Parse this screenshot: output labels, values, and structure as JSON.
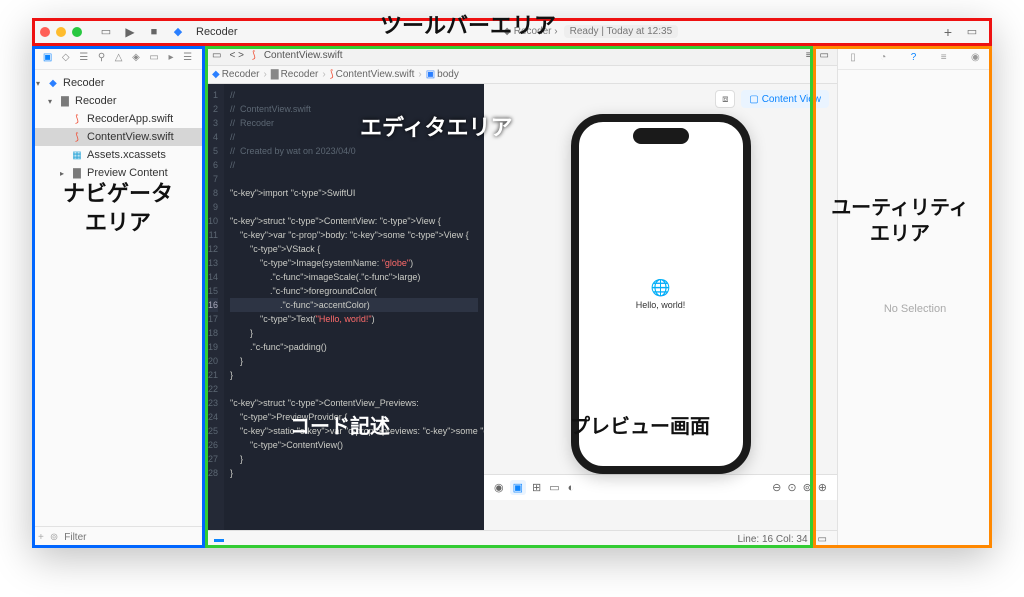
{
  "toolbar": {
    "app_title": "Recoder",
    "tab_label": "Recoder",
    "status_ready": "Ready",
    "status_time": "Today at 12:35"
  },
  "navigator": {
    "project": "Recoder",
    "target": "Recoder",
    "files": {
      "app": "RecoderApp.swift",
      "contentview": "ContentView.swift",
      "assets": "Assets.xcassets",
      "preview": "Preview Content"
    },
    "filter_placeholder": "Filter"
  },
  "editor": {
    "tab_file": "ContentView.swift",
    "crumb_app": "Recoder",
    "crumb_target": "Recoder",
    "crumb_file": "ContentView.swift",
    "crumb_symbol": "body",
    "code_lines": [
      "//",
      "//  ContentView.swift",
      "//  Recoder",
      "//",
      "//  Created by wat on 2023/04/0",
      "//",
      "",
      "import SwiftUI",
      "",
      "struct ContentView: View {",
      "    var body: some View {",
      "        VStack {",
      "            Image(systemName: \"globe\")",
      "                .imageScale(.large)",
      "                .foregroundColor(",
      "                    .accentColor)",
      "            Text(\"Hello, world!\")",
      "        }",
      "        .padding()",
      "    }",
      "}",
      "",
      "struct ContentView_Previews:",
      "    PreviewProvider {",
      "    static var previews: some View {",
      "        ContentView()",
      "    }",
      "}"
    ],
    "current_line": 16
  },
  "preview": {
    "badge": "Content View",
    "app_text": "Hello, world!"
  },
  "status": {
    "line_col": "Line: 16  Col: 34"
  },
  "utility": {
    "no_selection": "No Selection"
  },
  "annotations": {
    "toolbar": "ツールバーエリア",
    "navigator": "ナビゲータ\nエリア",
    "editor": "エディタエリア",
    "code": "コード記述",
    "preview": "プレビュー画面",
    "utility": "ユーティリティ\nエリア"
  }
}
